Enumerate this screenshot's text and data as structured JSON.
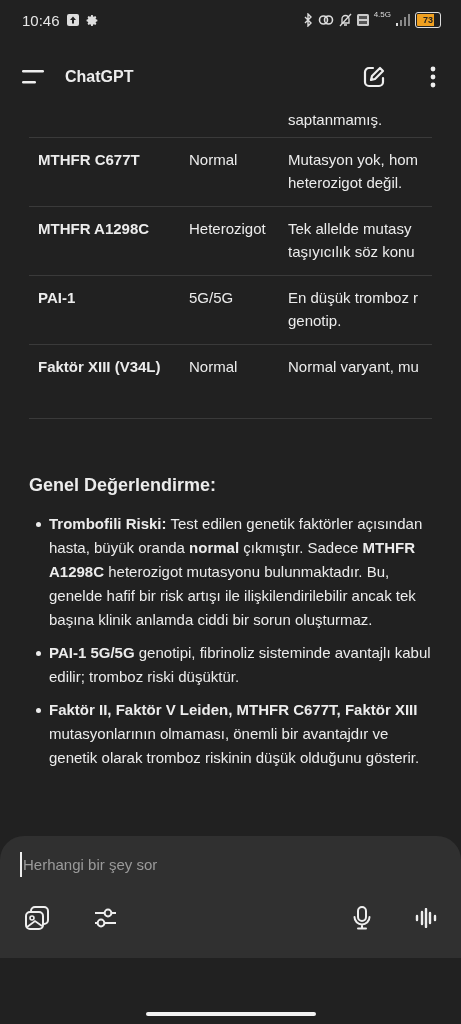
{
  "status_bar": {
    "time": "10:46",
    "network": "4.5G",
    "battery": "73"
  },
  "header": {
    "title": "ChatGPT"
  },
  "table": {
    "partial_row": {
      "details": [
        "saptanmamış."
      ]
    },
    "rows": [
      {
        "test": "MTHFR C677T",
        "result": "Normal",
        "details": [
          "Mutasyon yok, hom",
          "heterozigot değil."
        ]
      },
      {
        "test": "MTHFR A1298C",
        "result": "Heterozigot",
        "details": [
          "Tek allelde mutasy",
          "taşıyıcılık söz konu"
        ]
      },
      {
        "test": "PAI-1",
        "result": "5G/5G",
        "details": [
          "En düşük tromboz r",
          "genotip."
        ]
      },
      {
        "test": "Faktör XIII (V34L)",
        "result": "Normal",
        "details": [
          "Normal varyant, mu"
        ]
      }
    ]
  },
  "section": {
    "heading": "Genel Değerlendirme:",
    "bullets": [
      "**Trombofili Riski:** Test edilen genetik faktörler açısından hasta, büyük oranda **normal** çıkmıştır. Sadece **MTHFR A1298C** heterozigot mutasyonu bulunmaktadır. Bu, genelde hafif bir risk artışı ile ilişkilendirilebilir ancak tek başına klinik anlamda ciddi bir sorun oluşturmaz.",
      "**PAI-1 5G/5G** genotipi, fibrinoliz sisteminde avantajlı kabul edilir; tromboz riski düşüktür.",
      "**Faktör II, Faktör V Leiden, MTHFR C677T, Faktör XIII** mutasyonlarının olmaması, önemli bir avantajdır ve genetik olarak tromboz riskinin düşük olduğunu gösterir."
    ]
  },
  "composer": {
    "placeholder": "Herhangi bir şey sor"
  }
}
